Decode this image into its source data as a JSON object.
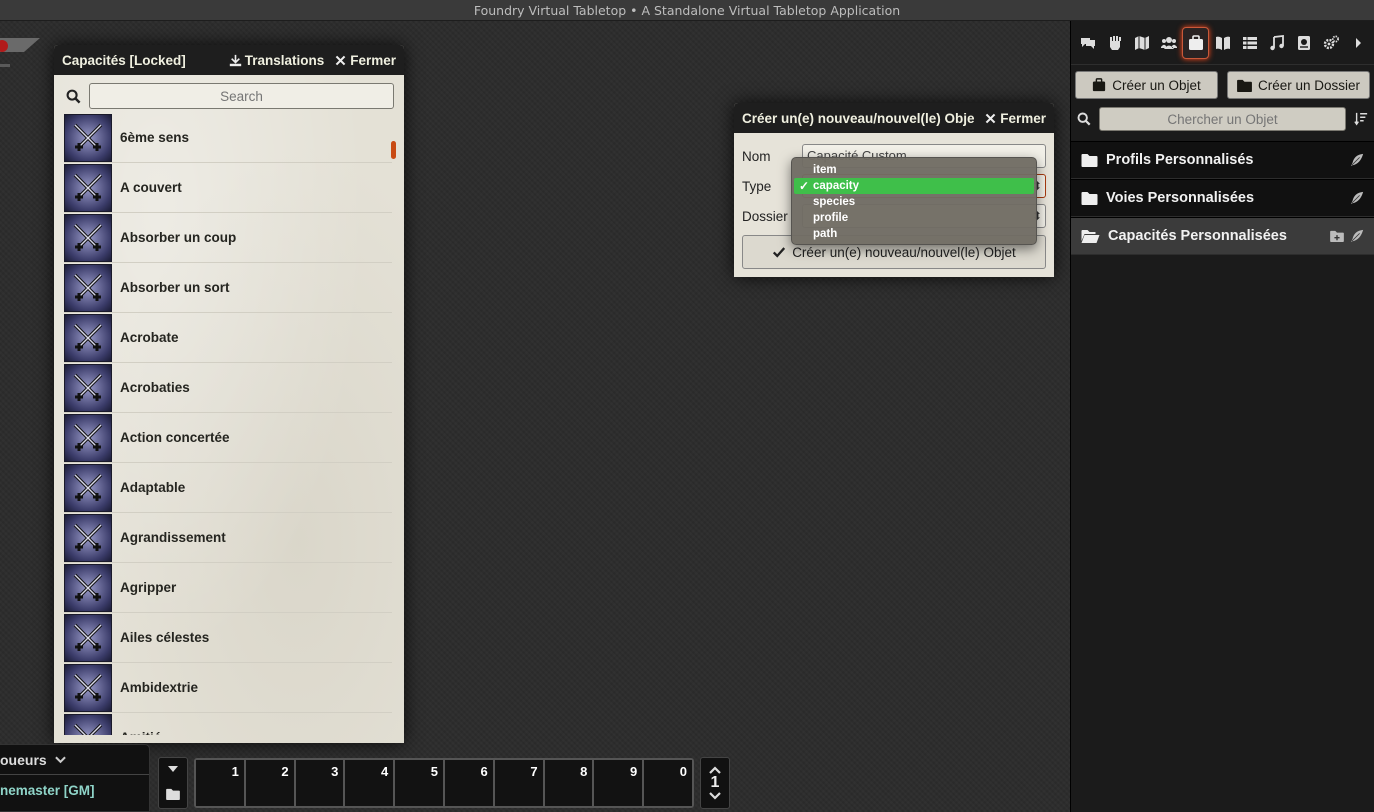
{
  "window_title": "Foundry Virtual Tabletop • A Standalone Virtual Tabletop Application",
  "compendium": {
    "title": "Capacités [Locked]",
    "translations_label": "Translations",
    "close_label": "Fermer",
    "search_placeholder": "Search",
    "items": [
      {
        "name": "6ème sens"
      },
      {
        "name": "A couvert"
      },
      {
        "name": "Absorber un coup"
      },
      {
        "name": "Absorber un sort"
      },
      {
        "name": "Acrobate"
      },
      {
        "name": "Acrobaties"
      },
      {
        "name": "Action concertée"
      },
      {
        "name": "Adaptable"
      },
      {
        "name": "Agrandissement"
      },
      {
        "name": "Agripper"
      },
      {
        "name": "Ailes célestes"
      },
      {
        "name": "Ambidextrie"
      },
      {
        "name": "Amitié"
      }
    ]
  },
  "dialog": {
    "title": "Créer un(e) nouveau/nouvel(le) Objet",
    "close_label": "Fermer",
    "name_label": "Nom",
    "name_value": "Capacité Custom",
    "type_label": "Type",
    "folder_label": "Dossier",
    "submit_label": "Créer un(e) nouveau/nouvel(le) Objet",
    "type_options": [
      "item",
      "capacity",
      "species",
      "profile",
      "path"
    ],
    "type_selected": "capacity"
  },
  "sidebar": {
    "tabs": [
      {
        "icon": "chat-icon"
      },
      {
        "icon": "combat-fist-icon"
      },
      {
        "icon": "map-icon"
      },
      {
        "icon": "actors-icon"
      },
      {
        "icon": "items-suitcase-icon",
        "active": true
      },
      {
        "icon": "journal-book-icon"
      },
      {
        "icon": "tables-list-icon"
      },
      {
        "icon": "playlist-music-icon"
      },
      {
        "icon": "compendium-atlas-icon"
      },
      {
        "icon": "settings-gears-icon"
      },
      {
        "icon": "collapse-caret-icon"
      }
    ],
    "create_item_label": "Créer un Objet",
    "create_folder_label": "Créer un Dossier",
    "search_placeholder": "Chercher un Objet",
    "folders": [
      {
        "name": "Profils Personnalisés",
        "expanded": false
      },
      {
        "name": "Voies Personnalisées",
        "expanded": false
      },
      {
        "name": "Capacités Personnalisées",
        "expanded": true
      }
    ]
  },
  "players": {
    "header": "oueurs",
    "rows": [
      "nemaster [GM]"
    ]
  },
  "hotbar": {
    "slots": [
      "1",
      "2",
      "3",
      "4",
      "5",
      "6",
      "7",
      "8",
      "9",
      "0"
    ],
    "page": "1"
  },
  "colors": {
    "accent": "#c84a13",
    "selected_option": "#3fbf4a",
    "gm_name": "#8fd4c8"
  }
}
